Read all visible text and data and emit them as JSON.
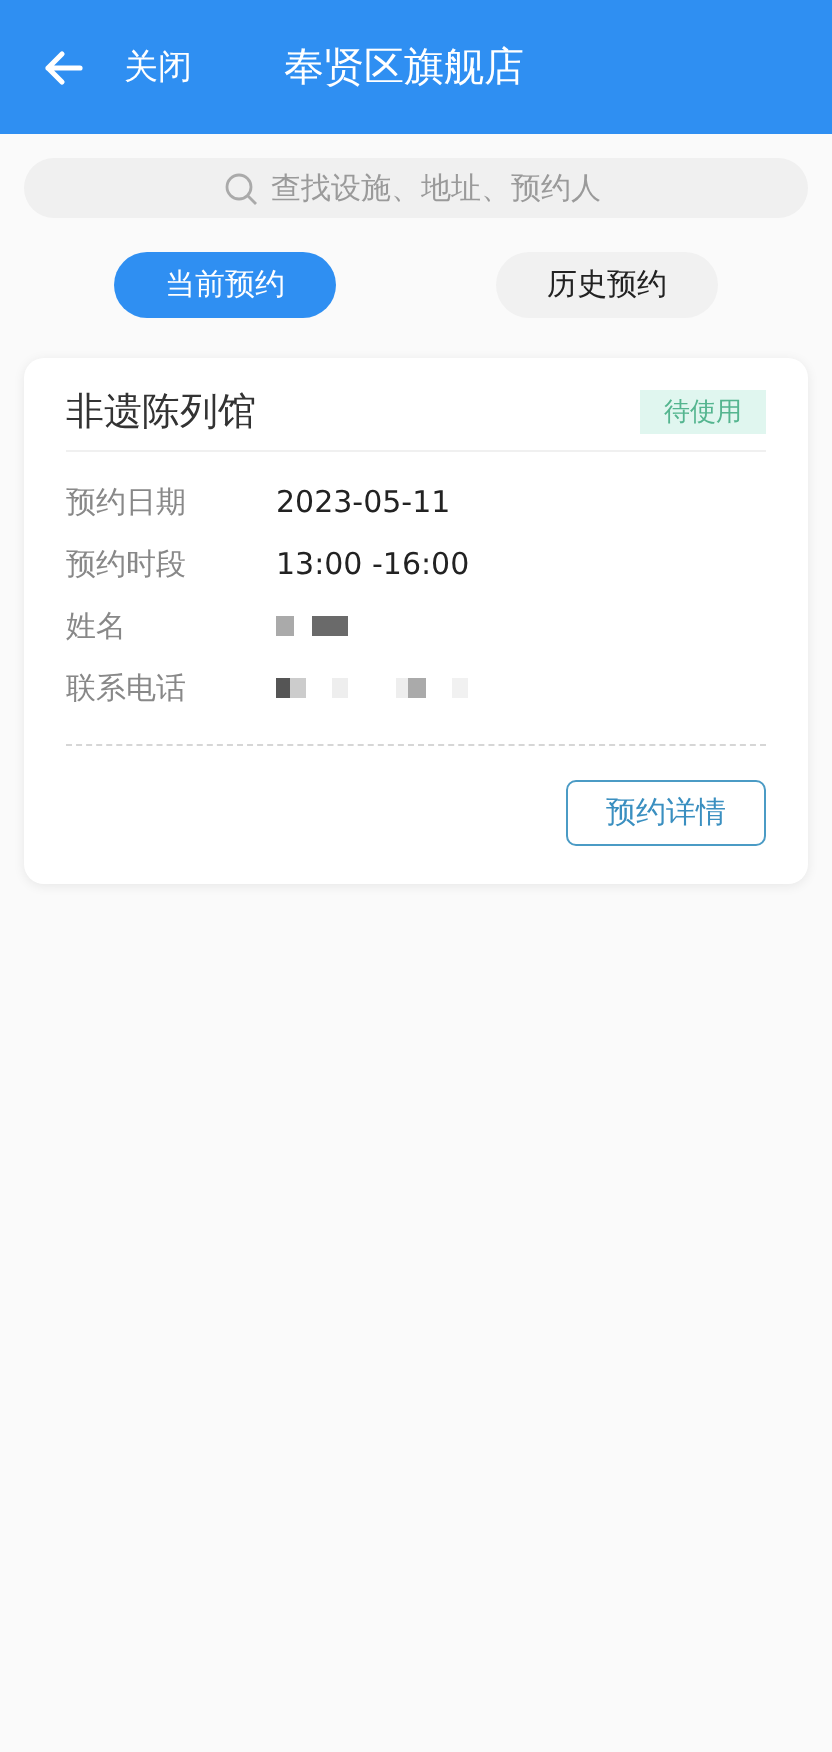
{
  "header": {
    "back_label": "关闭",
    "title": "奉贤区旗舰店"
  },
  "search": {
    "placeholder": "查找设施、地址、预约人"
  },
  "tabs": [
    {
      "label": "当前预约",
      "selected": true
    },
    {
      "label": "历史预约",
      "selected": false
    }
  ],
  "bookings": [
    {
      "venue": "非遗陈列馆",
      "status": "待使用",
      "fields": [
        {
          "kind": "text",
          "label": "预约日期",
          "value": "2023-05-11"
        },
        {
          "kind": "text",
          "label": "预约时段",
          "value": "13:00 -16:00"
        },
        {
          "kind": "redacted",
          "label": "姓名"
        },
        {
          "kind": "redacted",
          "label": "联系电话"
        }
      ],
      "action": "预约详情"
    }
  ]
}
